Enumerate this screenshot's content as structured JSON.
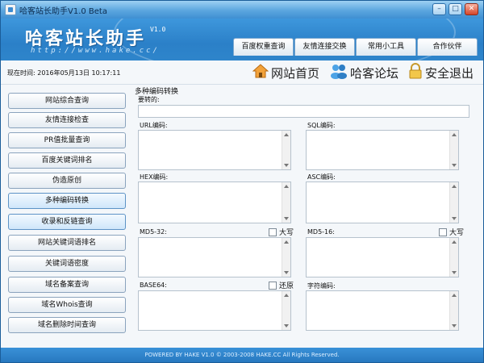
{
  "window": {
    "title": "哈客站长助手V1.0 Beta",
    "controls": [
      "–",
      "□",
      "✕"
    ]
  },
  "banner": {
    "brand": "哈客站长助手",
    "version": "V1.0",
    "url": "http://www.hake.cc/",
    "tabs": [
      "百度权重查询",
      "友情连接交换",
      "常用小工具",
      "合作伙伴"
    ]
  },
  "infobar": {
    "datetime": "现在时间: 2016年05月13日  10:17:11",
    "links": [
      {
        "label": "网站首页",
        "icon": "home-icon"
      },
      {
        "label": "哈客论坛",
        "icon": "forum-icon"
      },
      {
        "label": "安全退出",
        "icon": "lock-icon"
      }
    ]
  },
  "sidebar": {
    "items": [
      "网站综合查询",
      "友情连接检查",
      "PR值批量查询",
      "百度关键词排名",
      "伪造原创",
      "多种编码转换",
      "收录和反链查询",
      "网站关键词语排名",
      "关键词语密度",
      "域名备案查询",
      "域名Whois查询",
      "域名删除时间查询"
    ],
    "active_index": 5
  },
  "panel": {
    "title": "多种编码转换",
    "input_label": "要转的:",
    "input_value": "",
    "fields": {
      "url": "URL编码:",
      "sql": "SQL编码:",
      "hex": "HEX编码:",
      "asc": "ASC编码:",
      "md5_32": "MD5-32:",
      "md5_16": "MD5-16:",
      "base64": "BASE64:",
      "charcode": "字符编码:"
    },
    "checkboxes": {
      "md5_32_upper": "大写",
      "md5_16_upper": "大写",
      "base64_restore": "还原"
    }
  },
  "footer": {
    "text": "POWERED BY HAKE V1.0 © 2003-2008 HAKE.CC All Rights Reserved."
  }
}
